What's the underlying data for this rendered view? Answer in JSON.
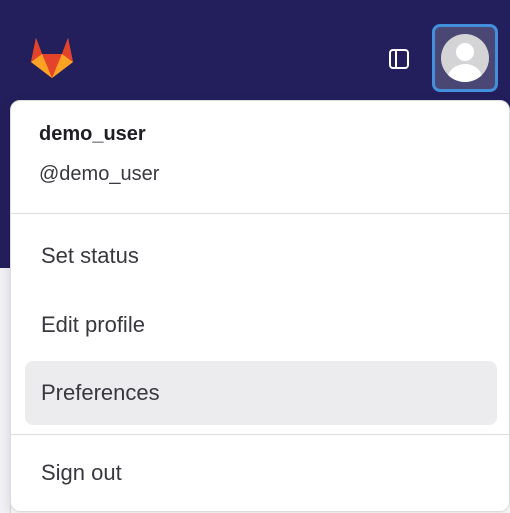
{
  "header": {
    "logo_icon": "gitlab-tanuki-icon",
    "sidebar_toggle_icon": "sidebar-toggle-icon",
    "avatar_icon": "user-avatar-icon",
    "bar_color": "#231f5c",
    "focus_color": "#428fdc"
  },
  "user_menu": {
    "name": "demo_user",
    "username": "@demo_user",
    "items": [
      {
        "label": "Set status"
      },
      {
        "label": "Edit profile"
      },
      {
        "label": "Preferences",
        "highlighted": true
      },
      {
        "label": "Sign out"
      }
    ]
  }
}
